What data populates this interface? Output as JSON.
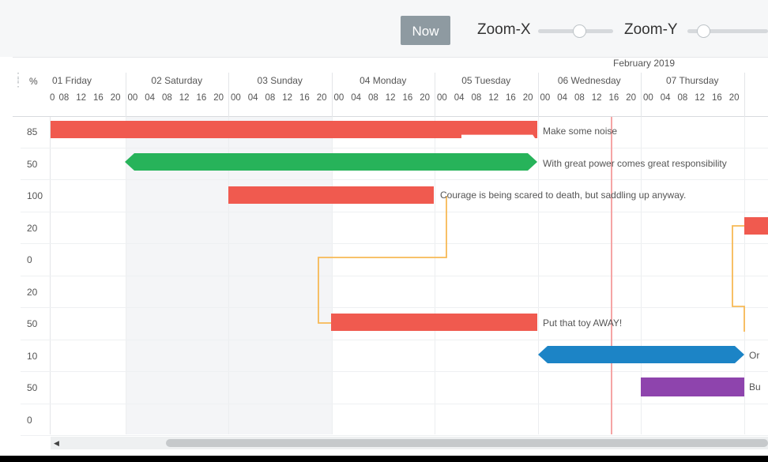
{
  "toolbar": {
    "now_label": "Now",
    "zoom_x_label": "Zoom-X",
    "zoom_y_label": "Zoom-Y",
    "zoom_x_level": 0.55,
    "zoom_y_level": 0.2
  },
  "header": {
    "percent_label": "%",
    "month_label": "February 2019",
    "days": [
      "01 Friday",
      "02 Saturday",
      "03 Sunday",
      "04 Monday",
      "05 Tuesday",
      "06 Wednesday",
      "07 Thursday"
    ],
    "hours": [
      "00",
      "04",
      "08",
      "12",
      "16",
      "20"
    ]
  },
  "rows": [
    {
      "percent": "85"
    },
    {
      "percent": "50"
    },
    {
      "percent": "100"
    },
    {
      "percent": "20"
    },
    {
      "percent": "0"
    },
    {
      "percent": "20"
    },
    {
      "percent": "50"
    },
    {
      "percent": "10"
    },
    {
      "percent": "50"
    },
    {
      "percent": "0"
    }
  ],
  "tasks": [
    {
      "label": "Make some noise",
      "color": "#f05a4f",
      "percent": 85
    },
    {
      "label": "With great power comes great responsibility",
      "color": "#27b35a",
      "percent": 50
    },
    {
      "label": "Courage is being scared to death, but saddling up anyway.",
      "color": "#f05a4f",
      "percent": 100
    },
    {
      "label": "",
      "color": "#f05a4f",
      "percent": 20
    },
    {
      "label": "Put that toy AWAY!",
      "color": "#f05a4f",
      "percent": 50
    },
    {
      "label": "Or",
      "color": "#1c84c6",
      "percent": 10
    },
    {
      "label": "Bu",
      "color": "#8e44ad",
      "percent": 50
    }
  ],
  "colors": {
    "now_line": "#f5a5a5",
    "dependency": "#f7b955",
    "weekend_shade": "#f4f5f7"
  }
}
